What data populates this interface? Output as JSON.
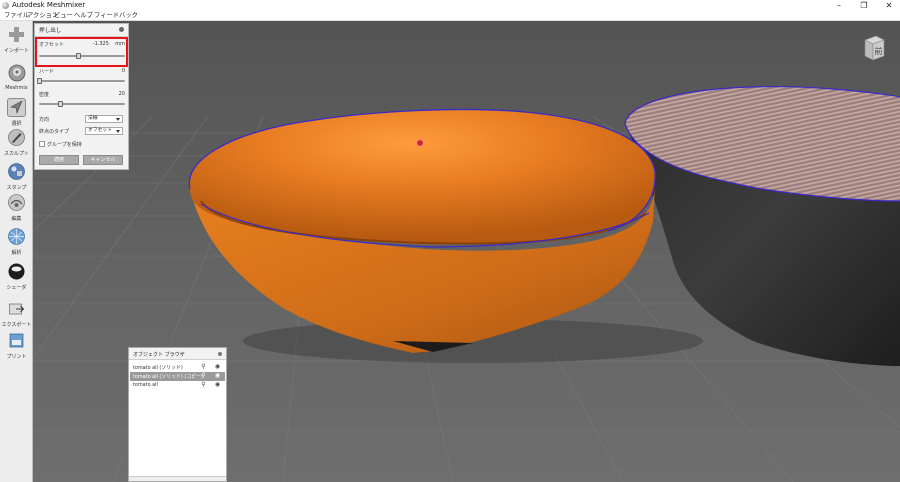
{
  "window": {
    "title": "Autodesk Meshmixer",
    "controls": [
      "–",
      "❐",
      "✕"
    ]
  },
  "menu": [
    "ファイル",
    "アクション",
    "ビュー",
    "ヘルプ",
    "フィードバック"
  ],
  "toolbar": [
    {
      "label": "インポート",
      "icon": "import-plus-icon"
    },
    {
      "label": "Meshmix",
      "icon": "meshmix-sphere-icon"
    },
    {
      "label": "選択",
      "icon": "select-cursor-icon"
    },
    {
      "label": "スカルプト",
      "icon": "sculpt-brush-icon"
    },
    {
      "label": "スタンプ",
      "icon": "stamp-icon"
    },
    {
      "label": "編集",
      "icon": "edit-icon"
    },
    {
      "label": "解析",
      "icon": "analysis-icon"
    },
    {
      "label": "シェーダ",
      "icon": "shader-icon"
    },
    {
      "label": "エクスポート",
      "icon": "export-icon"
    },
    {
      "label": "プリント",
      "icon": "print-icon"
    }
  ],
  "extrude_panel": {
    "title": "押し出し",
    "offset": {
      "label": "オフセット",
      "value": "-1.325",
      "unit": "mm",
      "level": 0.45
    },
    "harden": {
      "label": "ハード",
      "value": "0",
      "level": 0.0
    },
    "density": {
      "label": "密度",
      "value": "20",
      "level": 0.24
    },
    "direction": {
      "label": "方向",
      "value": "法線"
    },
    "end_type": {
      "label": "終点のタイプ",
      "value": "オフセット"
    },
    "preserve_group": {
      "label": "グループを保持",
      "checked": false
    },
    "apply_label": "適用",
    "cancel_label": "キャンセル"
  },
  "viewcube": {
    "face": "前"
  },
  "object_browser": {
    "title": "オブジェクト ブラウザ",
    "items": [
      {
        "name": "tomato all (ソリッド)",
        "selected": false
      },
      {
        "name": "tomato all (ソリッド) (コピー)",
        "selected": true
      },
      {
        "name": "tomato all",
        "selected": false
      }
    ]
  },
  "colors": {
    "bowl": "#e47a1e",
    "highlight": "#e6131a",
    "selection_outline": "#3a2ac8",
    "viewport_bg": "#5e5e5e"
  }
}
